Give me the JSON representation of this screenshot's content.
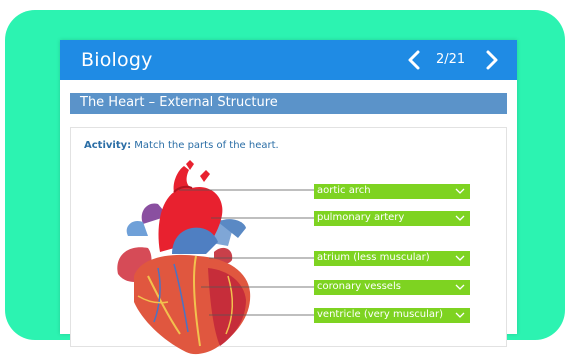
{
  "header": {
    "title": "Biology",
    "page_indicator": "2/21",
    "prev_icon": "chevron-left-icon",
    "next_icon": "chevron-right-icon"
  },
  "section": {
    "title": "The Heart – External Structure"
  },
  "activity": {
    "label": "Activity:",
    "instruction": " Match the parts of the heart."
  },
  "dropdowns": [
    {
      "value": "aortic arch"
    },
    {
      "value": "pulmonary artery"
    },
    {
      "value": "atrium (less muscular)"
    },
    {
      "value": "coronary vessels"
    },
    {
      "value": "ventricle (very muscular)"
    }
  ],
  "colors": {
    "frame": "#2cf3b1",
    "header": "#1f8be4",
    "section_bar": "#5b93c9",
    "dropdown": "#7ed321"
  }
}
